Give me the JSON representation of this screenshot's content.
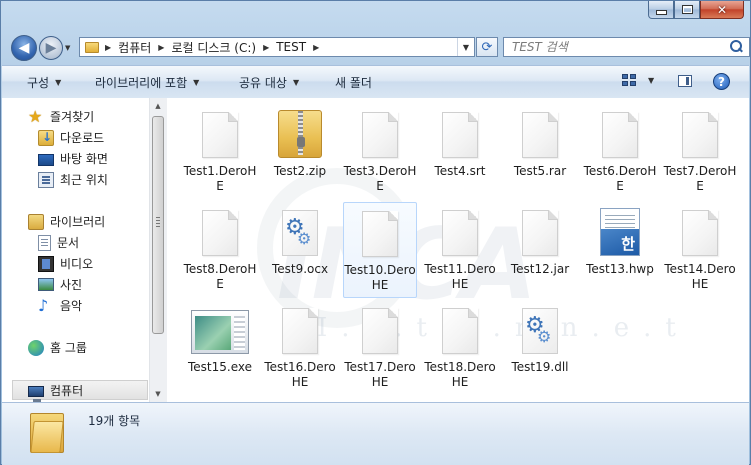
{
  "window": {
    "caption_minimize": "minimize",
    "caption_maximize": "maximize",
    "caption_close": "close"
  },
  "address": {
    "segments": [
      "컴퓨터",
      "로컬 디스크 (C:)",
      "TEST"
    ]
  },
  "search": {
    "placeholder": "TEST 검색"
  },
  "toolbar": {
    "organize_label": "구성",
    "include_library_label": "라이브러리에 포함",
    "share_label": "공유 대상",
    "new_folder_label": "새 폴더"
  },
  "sidebar": {
    "favorites": "즐겨찾기",
    "favorites_items": [
      "다운로드",
      "바탕 화면",
      "최근 위치"
    ],
    "libraries": "라이브러리",
    "libraries_items": [
      "문서",
      "비디오",
      "사진",
      "음악"
    ],
    "homegroup": "홈 그룹",
    "computer": "컴퓨터"
  },
  "files": [
    {
      "name": "Test1.DeroHE",
      "icon": "blank-file-icon"
    },
    {
      "name": "Test2.zip",
      "icon": "zip-folder-icon"
    },
    {
      "name": "Test3.DeroHE",
      "icon": "blank-file-icon"
    },
    {
      "name": "Test4.srt",
      "icon": "blank-file-icon"
    },
    {
      "name": "Test5.rar",
      "icon": "blank-file-icon"
    },
    {
      "name": "Test6.DeroHE",
      "icon": "blank-file-icon"
    },
    {
      "name": "Test7.DeroHE",
      "icon": "blank-file-icon"
    },
    {
      "name": "Test8.DeroHE",
      "icon": "blank-file-icon"
    },
    {
      "name": "Test9.ocx",
      "icon": "gear-file-icon"
    },
    {
      "name": "Test10.DeroHE",
      "icon": "blank-file-icon"
    },
    {
      "name": "Test11.DeroHE",
      "icon": "blank-file-icon"
    },
    {
      "name": "Test12.jar",
      "icon": "blank-file-icon"
    },
    {
      "name": "Test13.hwp",
      "icon": "hwp-file-icon"
    },
    {
      "name": "Test14.DeroHE",
      "icon": "blank-file-icon"
    },
    {
      "name": "Test15.exe",
      "icon": "exe-file-icon"
    },
    {
      "name": "Test16.DeroHE",
      "icon": "blank-file-icon"
    },
    {
      "name": "Test17.DeroHE",
      "icon": "blank-file-icon"
    },
    {
      "name": "Test18.DeroHE",
      "icon": "blank-file-icon"
    },
    {
      "name": "Test19.dll",
      "icon": "gear-file-icon"
    }
  ],
  "selected_file": "Test10.DeroHE",
  "watermark": {
    "logo": "INCA",
    "sub": "I.n.t.e.r.n.e.t"
  },
  "status": {
    "item_count": "19개 항목"
  },
  "icon_glyphs": {
    "back": "◀",
    "forward": "▶",
    "dropdown": "▼",
    "separator": "▶",
    "refresh": "⟳",
    "help": "?",
    "close": "✕",
    "star": "★",
    "music": "♪",
    "gear": "⚙",
    "hangul": "한"
  }
}
